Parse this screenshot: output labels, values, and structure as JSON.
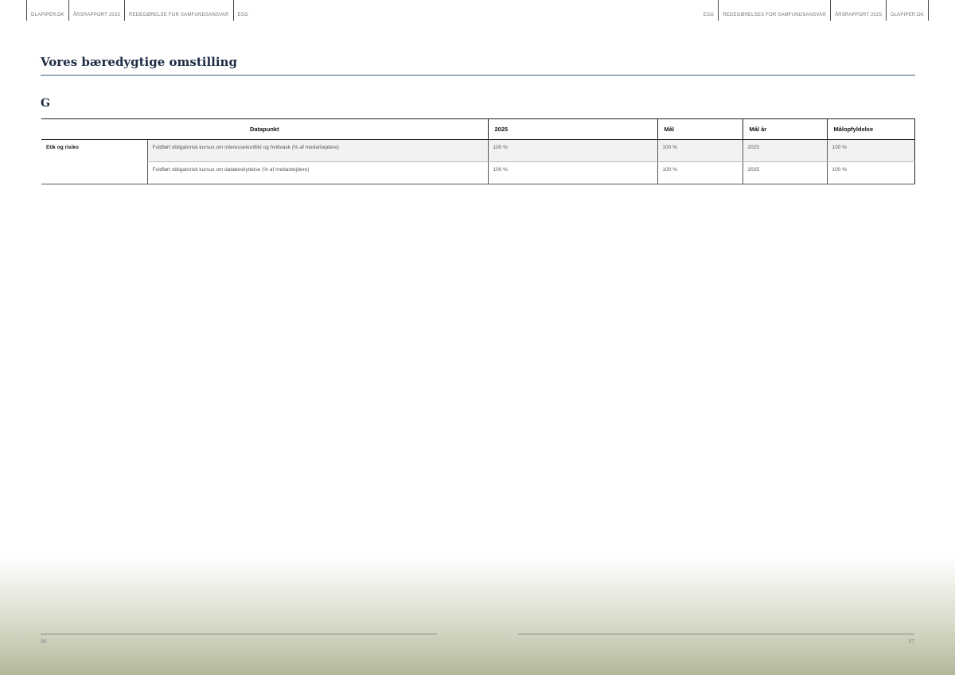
{
  "header_left": [
    "DLAPIPER.DK",
    "ÅRSRAPPORT 2025",
    "REDEGØRELSE  FOR SAMFUNDSANSVAR",
    "ESG"
  ],
  "header_right": [
    "ESG",
    "REDEGØRELSES FOR SAMFUNDSANSVAR",
    "ÅRSRAPPORT 2025",
    "DLAPIPER.DK"
  ],
  "title": "Vores bæredygtige omstilling",
  "section": "G",
  "table": {
    "headers": [
      "Datapunkt",
      "2025",
      "Mål",
      "Mål år",
      "Målopfyldelse"
    ],
    "category": "Etik og risiko",
    "rows": [
      [
        "Fuldført obligatorisk kursus om interessekonflikt og hvidvask (% af medarbejdere)",
        "100 %",
        "100 %",
        "2025",
        "100 %"
      ],
      [
        "Fuldført obligatorisk kursus om databeskyttelse (% af medarbejdere)",
        "100 %",
        "100 %",
        "2025",
        "100 %"
      ]
    ]
  },
  "footer": {
    "page_left": "96",
    "page_right": "97"
  }
}
